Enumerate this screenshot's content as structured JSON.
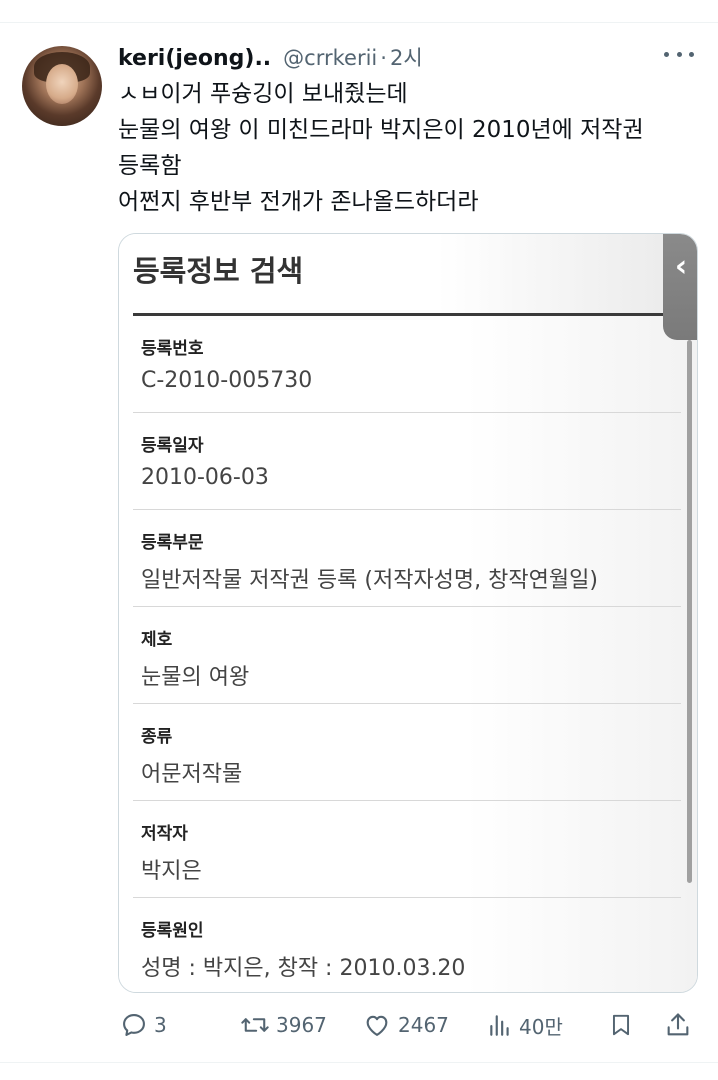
{
  "tweet": {
    "display_name": "keri(jeong)..",
    "handle": "@crrkerii",
    "separator": "·",
    "time": "2시",
    "text_lines": [
      "ㅅㅂ이거 푸슝깅이 보내줬는데",
      "눈물의 여왕 이 미친드라마 박지은이 2010년에 저작권",
      "등록함",
      "어쩐지 후반부 전개가 존나올드하더라"
    ]
  },
  "card": {
    "title": "등록정보 검색",
    "fields": [
      {
        "label": "등록번호",
        "value": "C-2010-005730"
      },
      {
        "label": "등록일자",
        "value": "2010-06-03"
      },
      {
        "label": "등록부문",
        "value": "일반저작물 저작권 등록  (저작자성명, 창작연월일)"
      },
      {
        "label": "제호",
        "value": "눈물의 여왕"
      },
      {
        "label": "종류",
        "value": "어문저작물"
      },
      {
        "label": "저작자",
        "value": "박지은"
      },
      {
        "label": "등록원인",
        "value": "성명 : 박지은, 창작 : 2010.03.20"
      }
    ]
  },
  "actions": {
    "reply_count": "3",
    "retweet_count": "3967",
    "like_count": "2467",
    "views_count": "40만"
  },
  "icons": {
    "reply": "reply-icon",
    "retweet": "retweet-icon",
    "like": "heart-icon",
    "views": "views-icon",
    "bookmark": "bookmark-icon",
    "share": "share-icon",
    "more": "more-icon",
    "collapse": "chevron-left-icon"
  },
  "colors": {
    "text_primary": "#0f1419",
    "text_secondary": "#536471",
    "border": "#cfd9de"
  }
}
